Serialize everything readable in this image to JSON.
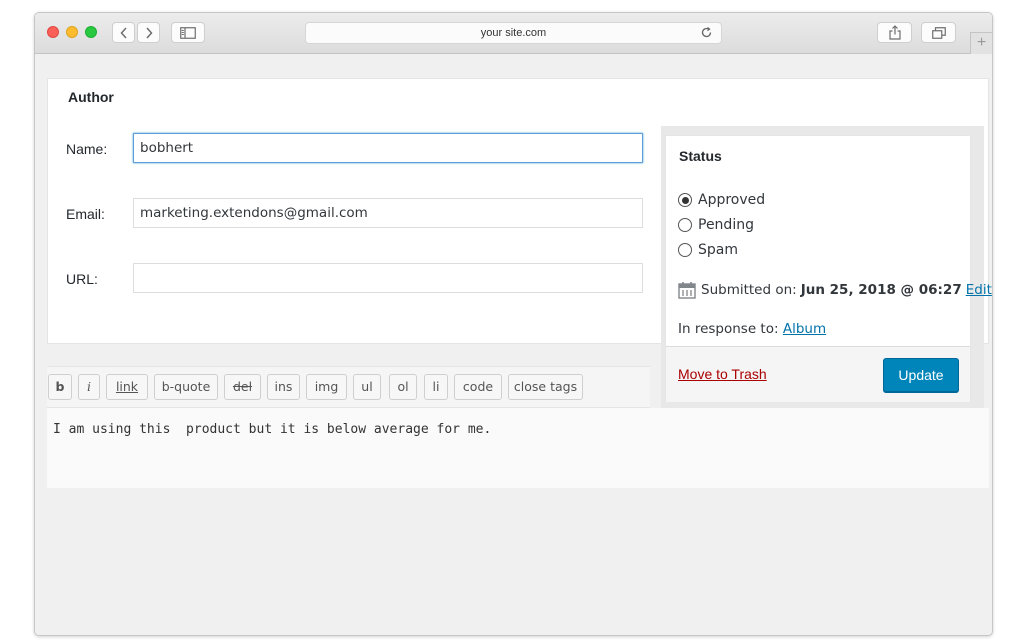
{
  "browser": {
    "url": "your site.com"
  },
  "author": {
    "title": "Author",
    "name_label": "Name:",
    "name_value": "bobhert",
    "email_label": "Email:",
    "email_value": "marketing.extendons@gmail.com",
    "url_label": "URL:",
    "url_value": ""
  },
  "status": {
    "title": "Status",
    "options": [
      {
        "label": "Approved",
        "checked": true
      },
      {
        "label": "Pending",
        "checked": false
      },
      {
        "label": "Spam",
        "checked": false
      }
    ],
    "submitted_label": "Submitted on:",
    "submitted_date": "Jun 25, 2018 @ 06:27",
    "edit_label": "Edit",
    "response_label": "In response to:",
    "response_link": "Album",
    "trash_label": "Move to Trash",
    "update_label": "Update"
  },
  "editor": {
    "buttons": [
      "b",
      "i",
      "link",
      "b-quote",
      "del",
      "ins",
      "img",
      "ul",
      "ol",
      "li",
      "code",
      "close tags"
    ],
    "content": "I am using this  product but it is below average for me."
  },
  "colors": {
    "primary_button": "#0085ba",
    "link": "#0073aa",
    "trash": "#aa0000",
    "focus_border": "#5b9dd9"
  }
}
